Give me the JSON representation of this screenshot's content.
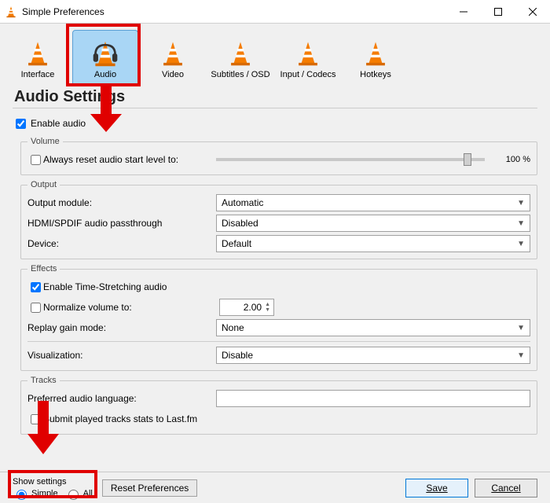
{
  "window": {
    "title": "Simple Preferences"
  },
  "tabs": {
    "interface": "Interface",
    "audio": "Audio",
    "video": "Video",
    "subtitles": "Subtitles / OSD",
    "codecs": "Input / Codecs",
    "hotkeys": "Hotkeys"
  },
  "page": {
    "heading": "Audio Settings",
    "enable_audio": "Enable audio"
  },
  "volume": {
    "legend": "Volume",
    "reset_label": "Always reset audio start level to:",
    "percent": "100 %"
  },
  "output": {
    "legend": "Output",
    "module_label": "Output module:",
    "module_value": "Automatic",
    "passthrough_label": "HDMI/SPDIF audio passthrough",
    "passthrough_value": "Disabled",
    "device_label": "Device:",
    "device_value": "Default"
  },
  "effects": {
    "legend": "Effects",
    "time_stretch": "Enable Time-Stretching audio",
    "normalize": "Normalize volume to:",
    "normalize_value": "2.00",
    "replay_label": "Replay gain mode:",
    "replay_value": "None",
    "viz_label": "Visualization:",
    "viz_value": "Disable"
  },
  "tracks": {
    "legend": "Tracks",
    "pref_lang": "Preferred audio language:",
    "lastfm": "Submit played tracks stats to Last.fm"
  },
  "footer": {
    "show_settings": "Show settings",
    "simple": "Simple",
    "all": "All",
    "reset": "Reset Preferences",
    "save": "Save",
    "cancel": "Cancel"
  }
}
